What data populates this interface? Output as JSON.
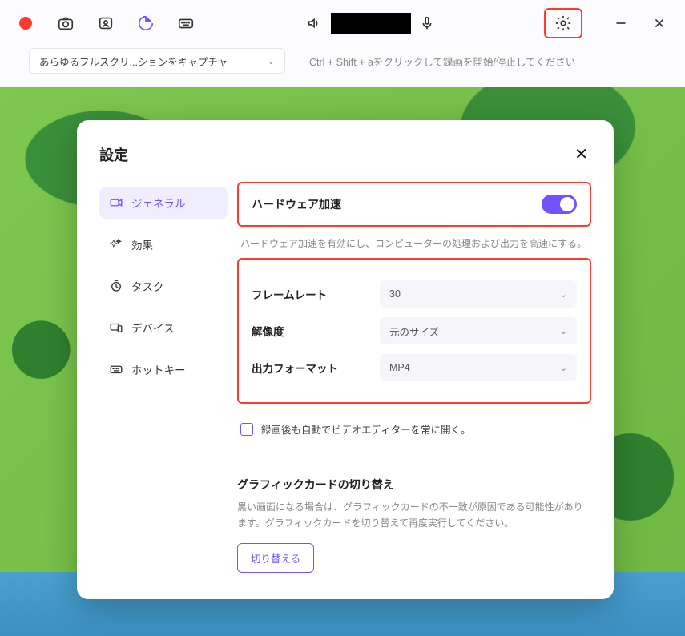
{
  "topbar": {
    "capture_mode": "あらゆるフルスクリ...ションをキャプチャ",
    "hint": "Ctrl + Shift + aをクリックして録画を開始/停止してください"
  },
  "modal": {
    "title": "設定"
  },
  "sidebar": {
    "items": [
      {
        "label": "ジェネラル"
      },
      {
        "label": "効果"
      },
      {
        "label": "タスク"
      },
      {
        "label": "デバイス"
      },
      {
        "label": "ホットキー"
      }
    ]
  },
  "panel": {
    "hw_accel_label": "ハードウェア加速",
    "hw_accel_desc": "ハードウェア加速を有効にし、コンピューターの処理および出力を高速にする。",
    "framerate_label": "フレームレート",
    "framerate_value": "30",
    "resolution_label": "解像度",
    "resolution_value": "元のサイズ",
    "format_label": "出力フォーマット",
    "format_value": "MP4",
    "auto_open_editor": "録画後も自動でビデオエディターを常に開く。",
    "gfx_title": "グラフィックカードの切り替え",
    "gfx_desc": "黒い画面になる場合は、グラフィックカードの不一致が原因である可能性があります。グラフィックカードを切り替えて再度実行してください。",
    "switch_button": "切り替える"
  }
}
